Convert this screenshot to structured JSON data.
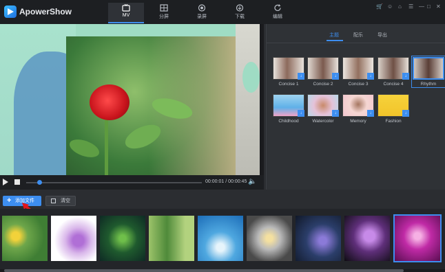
{
  "app": {
    "title": "ApowerShow"
  },
  "nav": {
    "tabs": [
      {
        "label": "MV",
        "icon": "tv-icon",
        "active": true
      },
      {
        "label": "分屏",
        "icon": "split-screen-icon",
        "active": false
      },
      {
        "label": "录屏",
        "icon": "record-icon",
        "active": false
      },
      {
        "label": "下载",
        "icon": "download-icon",
        "active": false
      },
      {
        "label": "编辑",
        "icon": "refresh-icon",
        "active": false
      }
    ]
  },
  "window_controls": [
    "cart-icon",
    "user-icon",
    "home-icon",
    "menu-icon",
    "minimize-icon",
    "maximize-icon",
    "close-icon"
  ],
  "player": {
    "time_current": "00:00:01",
    "time_total": "00:00:45",
    "time_sep": " / ",
    "progress": 0.03
  },
  "panel": {
    "tabs": [
      "主题",
      "配乐",
      "导出"
    ],
    "active_tab": 0,
    "themes": [
      {
        "name": "Concise 1",
        "row": 0
      },
      {
        "name": "Concise 2",
        "row": 0
      },
      {
        "name": "Concise 3",
        "row": 0
      },
      {
        "name": "Concise 4",
        "row": 0
      },
      {
        "name": "Rhythm",
        "row": 0,
        "selected": true
      },
      {
        "name": "Childhood",
        "row": 1
      },
      {
        "name": "Watercolor",
        "row": 1
      },
      {
        "name": "Memory",
        "row": 1
      },
      {
        "name": "Fashion",
        "row": 1
      }
    ]
  },
  "toolbar": {
    "add_label": "添加文件",
    "clear_label": "清空"
  },
  "media": {
    "items": [
      {
        "name": "yellow-rose-garden"
      },
      {
        "name": "purple-orchid"
      },
      {
        "name": "green-leaves-dew"
      },
      {
        "name": "green-stems-flower"
      },
      {
        "name": "blue-water-drop"
      },
      {
        "name": "white-flower-drops"
      },
      {
        "name": "purple-bell-flower"
      },
      {
        "name": "purple-flower-cluster"
      },
      {
        "name": "pink-flower-drops",
        "selected": true
      }
    ]
  },
  "colors": {
    "accent": "#3d8ef0",
    "background": "#2b2d31",
    "titlebar": "#1d1f22"
  }
}
